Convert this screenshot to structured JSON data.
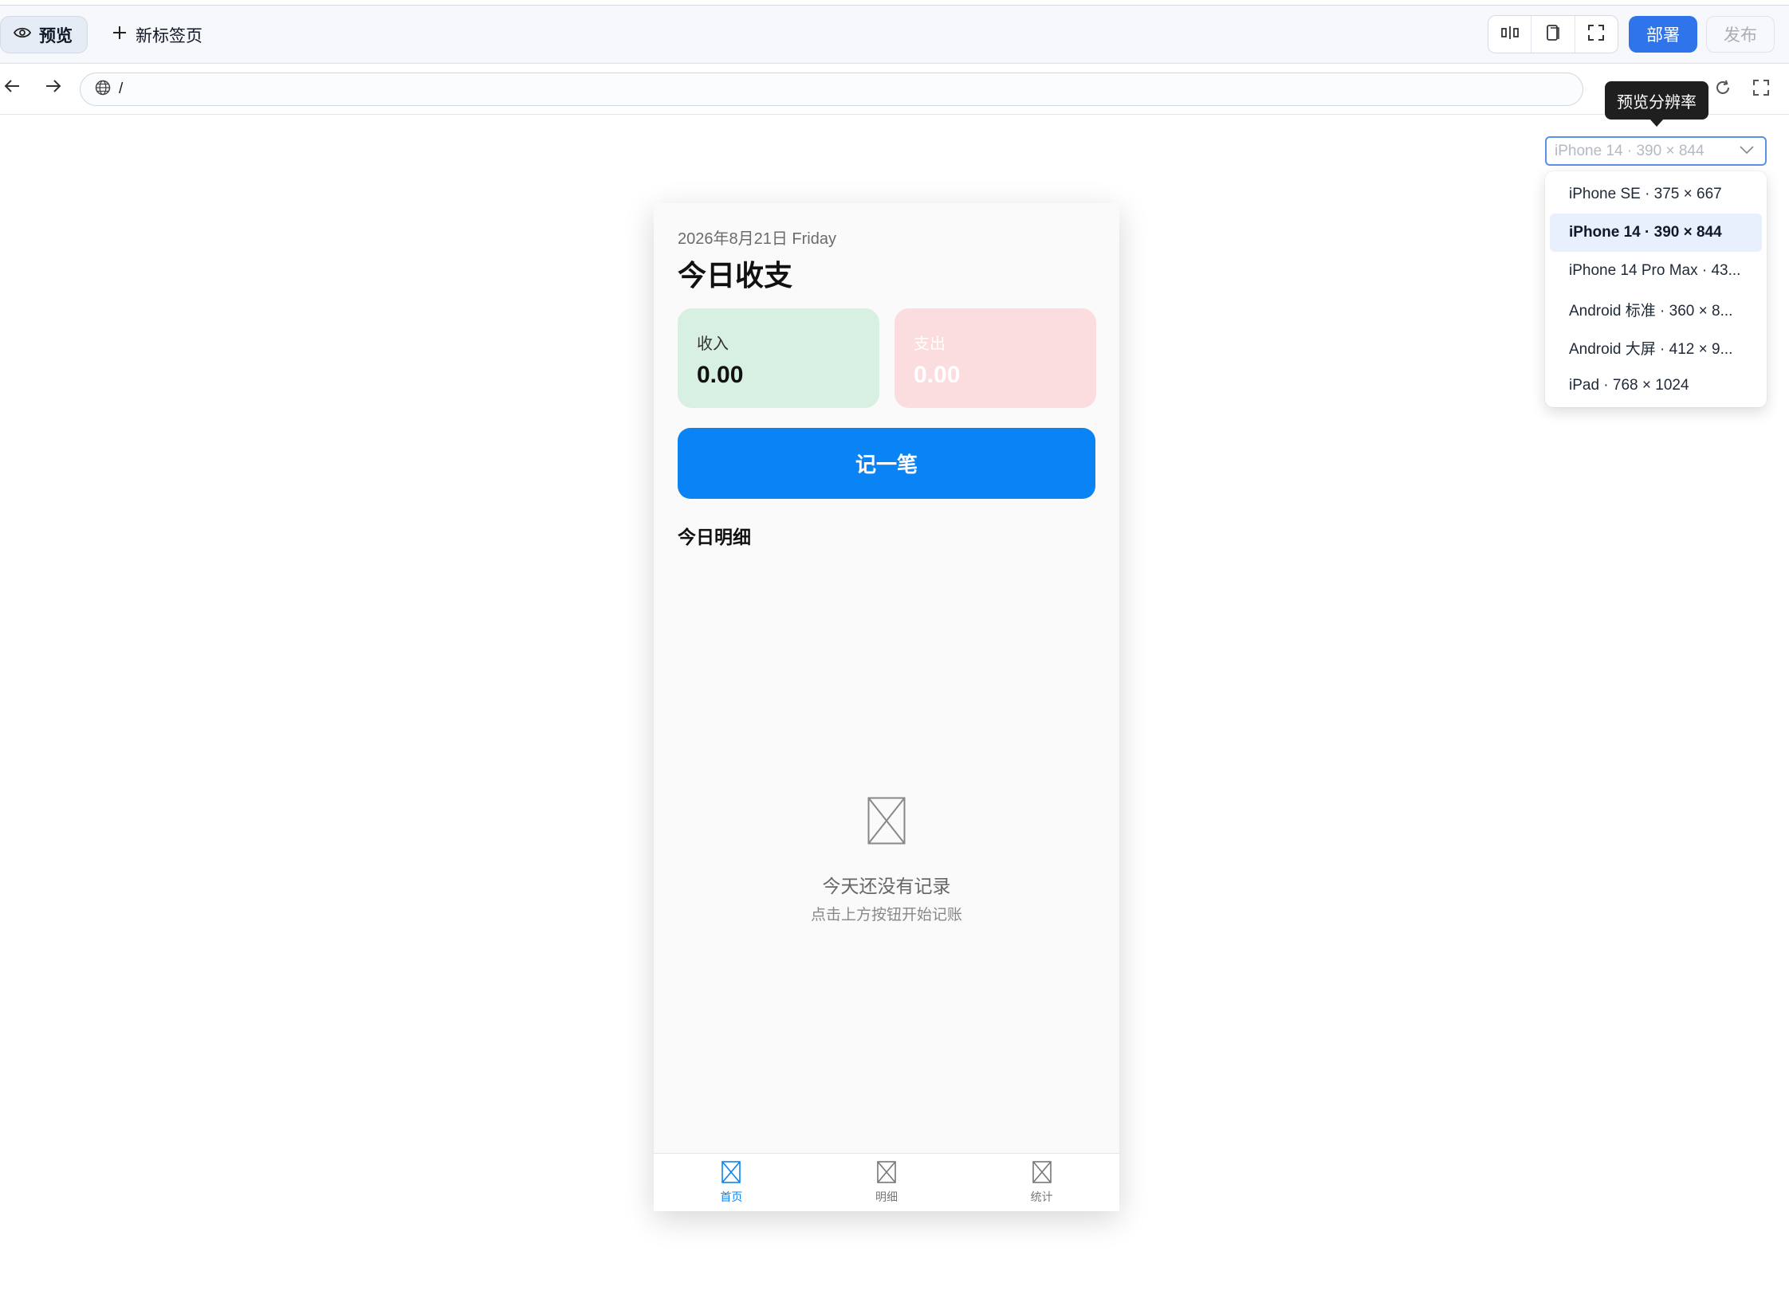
{
  "toolbar": {
    "preview_tab": "预览",
    "new_tab": "新标签页",
    "deploy_label": "部署",
    "publish_label": "发布"
  },
  "address": {
    "url": "/"
  },
  "tooltip": {
    "text": "预览分辨率"
  },
  "resolution": {
    "selected": "iPhone 14 · 390 × 844",
    "options": [
      "iPhone SE · 375 × 667",
      "iPhone 14 · 390 × 844",
      "iPhone 14 Pro Max · 43...",
      "Android 标准 · 360 × 8...",
      "Android 大屏 · 412 × 9...",
      "iPad · 768 × 1024"
    ]
  },
  "app": {
    "date": "2026年8月21日 Friday",
    "title": "今日收支",
    "income_label": "收入",
    "income_value": "0.00",
    "expense_label": "支出",
    "expense_value": "0.00",
    "record_button": "记一笔",
    "section_title": "今日明细",
    "empty_title": "今天还没有记录",
    "empty_subtitle": "点击上方按钮开始记账",
    "tabs": [
      "首页",
      "明细",
      "统计"
    ]
  },
  "colors": {
    "accent": "#2f74ea",
    "app_primary": "#0a84f5",
    "income_bg": "#d8f0e2",
    "expense_bg": "#fbdcdf"
  }
}
